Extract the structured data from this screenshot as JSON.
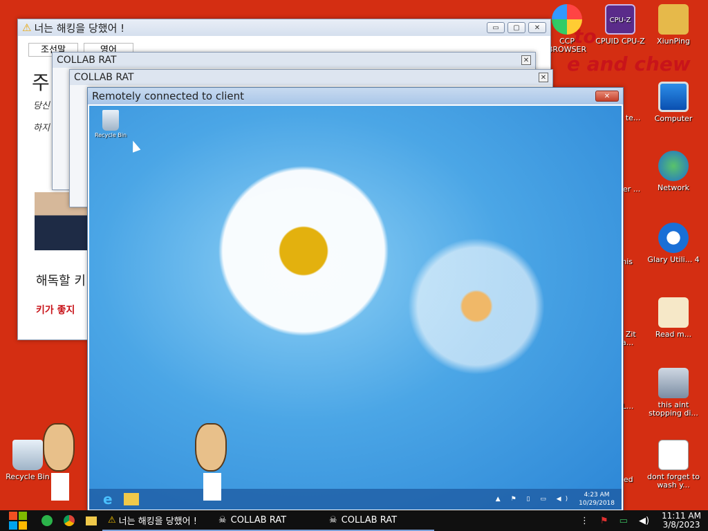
{
  "desktop": {
    "background_color": "#d42e12",
    "banner_lines": [
      "to",
      "e and chew"
    ],
    "icons": [
      {
        "name": "CCP BROWSER",
        "icon": "browser-icon"
      },
      {
        "name": "CPUID CPU-Z",
        "icon": "cpu-z-icon",
        "badge": "CPU-Z"
      },
      {
        "name": "XiunPing",
        "icon": "folder-user-icon"
      },
      {
        "name": "Computer",
        "icon": "computer-icon"
      },
      {
        "name": "Network",
        "icon": "network-icon"
      },
      {
        "name": "Glary Utili... 4",
        "icon": "glary-utilities-icon"
      },
      {
        "name": "Read m...",
        "icon": "readme-icon"
      },
      {
        "name": "this aint stopping di...",
        "icon": "disk-cleanup-icon"
      },
      {
        "name": "dont forget to wash y...",
        "icon": "document-icon"
      },
      {
        "name": "Recycle Bin",
        "icon": "recycle-bin-icon"
      }
    ],
    "partial_labels": [
      "are te...",
      "ed er ...",
      "this",
      "at Zit Ya...",
      "LL...",
      "ried"
    ]
  },
  "ransom_window": {
    "title": "너는 해킹을 당했어 !",
    "tabs": [
      "조선말",
      "영어"
    ],
    "heading_char": "주",
    "lines": [
      "당신",
      "하지"
    ],
    "decrypt_text": "해독할 키",
    "key_text": "키가 좋지"
  },
  "collab_windows": [
    {
      "title": "COLLAB RAT"
    },
    {
      "title": "COLLAB RAT"
    }
  ],
  "remote_window": {
    "title": "Remotely connected to client",
    "desktop_icon_label": "Recycle Bin",
    "clock_time": "4:23 AM",
    "clock_date": "10/29/2018"
  },
  "taskbar": {
    "items": [
      {
        "label": "너는 해킹을 당했어 !",
        "icon": "warning-icon"
      },
      {
        "label": "COLLAB RAT",
        "icon": "skull-icon"
      },
      {
        "label": "COLLAB RAT",
        "icon": "skull-icon"
      }
    ],
    "time": "11:11 AM",
    "date": "3/8/2023"
  }
}
